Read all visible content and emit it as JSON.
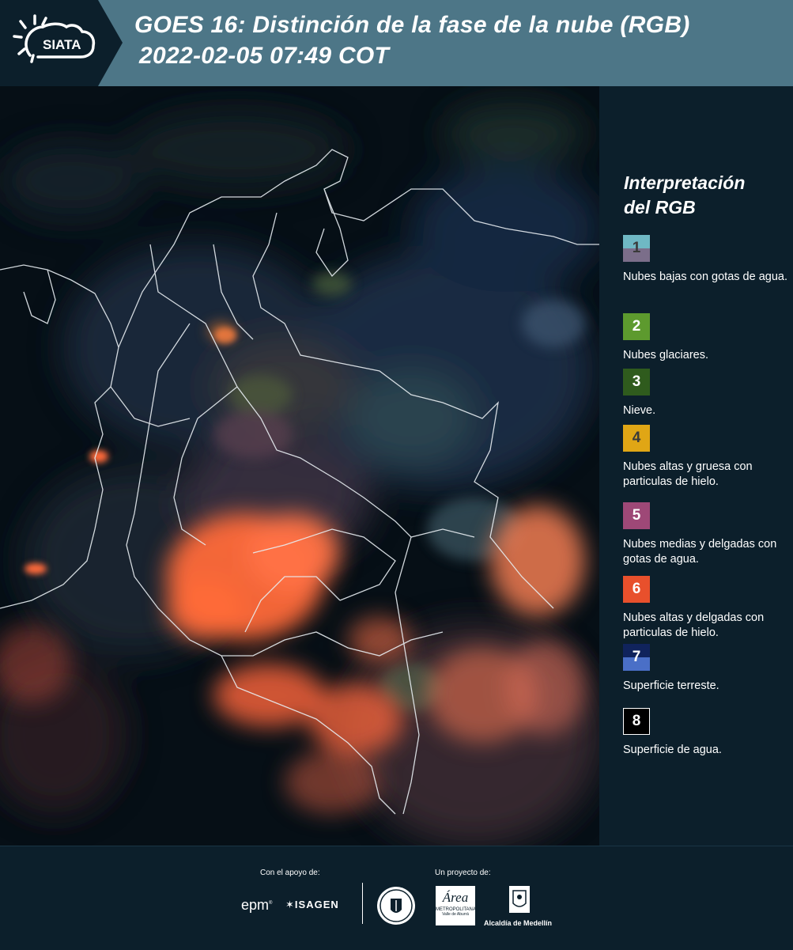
{
  "header": {
    "logo_text": "SIATA",
    "title_line1": "GOES 16: Distinción de la fase de la nube (RGB)",
    "title_line2": "2022-02-05 07:49 COT"
  },
  "legend": {
    "title_line1": "Interpretación",
    "title_line2": "del RGB",
    "items": [
      {
        "num": "1",
        "label": "Nubes bajas con gotas de agua.",
        "color_top": "#6fb8c4",
        "color_bottom": "#7b6e8a"
      },
      {
        "num": "2",
        "label": "Nubes glaciares.",
        "color_top": "#5d9a2e",
        "color_bottom": "#5d9a2e"
      },
      {
        "num": "3",
        "label": "Nieve.",
        "color_top": "#2f5b1d",
        "color_bottom": "#2f5b1d"
      },
      {
        "num": "4",
        "label": "Nubes altas y gruesa con particulas de hielo.",
        "color_top": "#e0a615",
        "color_bottom": "#e0a615"
      },
      {
        "num": "5",
        "label": "Nubes medias y delgadas con gotas de agua.",
        "color_top": "#9e4877",
        "color_bottom": "#9e4877"
      },
      {
        "num": "6",
        "label": "Nubes altas y delgadas con particulas de hielo.",
        "color_top": "#e8502c",
        "color_bottom": "#e8502c"
      },
      {
        "num": "7",
        "label": "Superficie terreste.",
        "color_top": "#10235c",
        "color_bottom": "#4a6fc7"
      },
      {
        "num": "8",
        "label": "Superficie de agua.",
        "color_top": "#000000",
        "color_bottom": "#000000"
      }
    ]
  },
  "footer": {
    "support_label": "Con el apoyo de:",
    "project_label": "Un proyecto de:",
    "sponsor_epm": "epm",
    "sponsor_isagen": "ISAGEN",
    "area_line1": "Área",
    "area_line2": "METROPOLITANA",
    "area_line3": "Valle de Aburrá",
    "alcaldia": "Alcaldía de Medellín"
  },
  "colors": {
    "header_bg": "#4d7687",
    "logo_bg": "#0c1f2b",
    "panel_bg": "#0c1f2b",
    "cloud_orange": "#ff6a3a"
  }
}
